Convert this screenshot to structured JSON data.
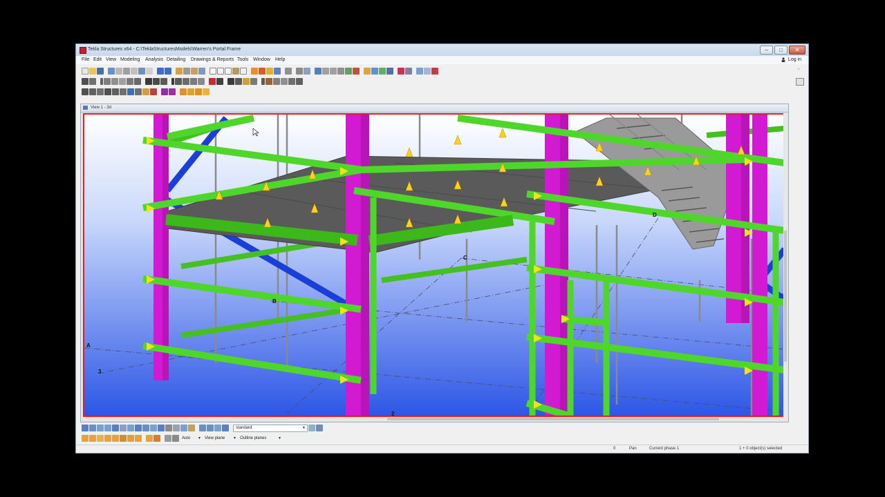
{
  "window": {
    "title": "Tekla Structures x64 - C:\\TeklaStructuresModels\\Warren's Portal Frame",
    "controls": [
      "–",
      "□",
      "✕"
    ]
  },
  "menu": {
    "items": [
      "File",
      "Edit",
      "View",
      "Modeling",
      "Analysis",
      "Detailing",
      "Drawings & Reports",
      "Tools",
      "Window",
      "Help"
    ],
    "login": "Log in"
  },
  "view": {
    "tab_label": "View 1 - 3d",
    "grid_labels": {
      "a": "A",
      "b": "B",
      "c": "C",
      "d": "D",
      "n3": "3",
      "n2": "2"
    }
  },
  "bottom_toolbar": {
    "view_filter": "standard",
    "snap_mode": "Auto",
    "plane_mode": "View plane",
    "outline_mode": "Outline planes"
  },
  "status": {
    "coord": "0",
    "mode": "Pan",
    "phase": "Current phase 1",
    "selection": "1 + 0 object(s) selected"
  },
  "colors": {
    "column": "#d21ad2",
    "beam": "#4fd62a",
    "brace": "#1a3fd8",
    "slab": "#5a5a5a",
    "view_border": "#e81a1a",
    "sky_top": "#ffffff",
    "sky_bottom": "#2d56e6"
  }
}
